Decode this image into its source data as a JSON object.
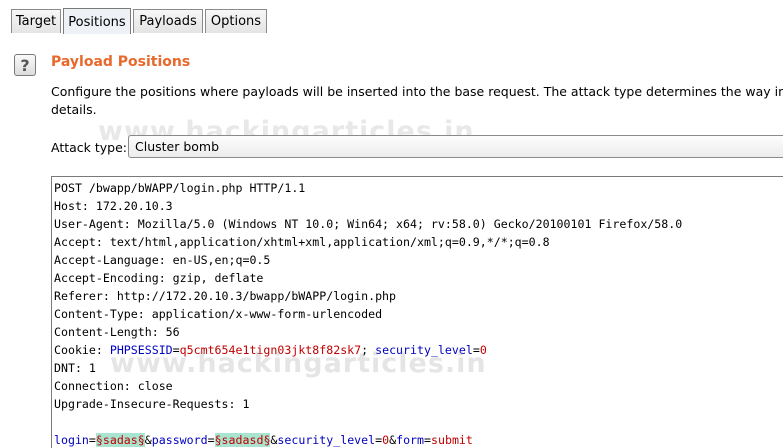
{
  "tabs": [
    "Target",
    "Positions",
    "Payloads",
    "Options"
  ],
  "active_tab": "Positions",
  "help_icon": "question-mark-icon",
  "section": {
    "title": "Payload Positions",
    "description_line1": "Configure the positions where payloads will be inserted into the base request. The attack type determines the way in which pay",
    "description_line2": "details."
  },
  "watermark": "www.hackingarticles.in",
  "attack": {
    "label": "Attack type:",
    "value": "Cluster bomb"
  },
  "request": {
    "lines": [
      "POST /bwapp/bWAPP/login.php HTTP/1.1",
      "Host: 172.20.10.3",
      "User-Agent: Mozilla/5.0 (Windows NT 10.0; Win64; x64; rv:58.0) Gecko/20100101 Firefox/58.0",
      "Accept: text/html,application/xhtml+xml,application/xml;q=0.9,*/*;q=0.8",
      "Accept-Language: en-US,en;q=0.5",
      "Accept-Encoding: gzip, deflate",
      "Referer: http://172.20.10.3/bwapp/bWAPP/login.php",
      "Content-Type: application/x-www-form-urlencoded",
      "Content-Length: 56"
    ],
    "cookie": {
      "prefix": "Cookie: ",
      "name1": "PHPSESSID",
      "eq1": "=",
      "value1": "q5cmt654e1tign03jkt8f82sk7",
      "sep": "; ",
      "name2": "security_level",
      "eq2": "=",
      "value2": "0"
    },
    "lines_after": [
      "DNT: 1",
      "Connection: close",
      "Upgrade-Insecure-Requests: 1",
      ""
    ],
    "body": {
      "k1": "login",
      "eq": "=",
      "p1": "§sadas§",
      "amp1": "&",
      "k2": "password",
      "p2": "§sadasd§",
      "amp2": "&",
      "k3": "security_level",
      "v3": "0",
      "amp3": "&",
      "k4": "form",
      "v4": "submit"
    }
  }
}
